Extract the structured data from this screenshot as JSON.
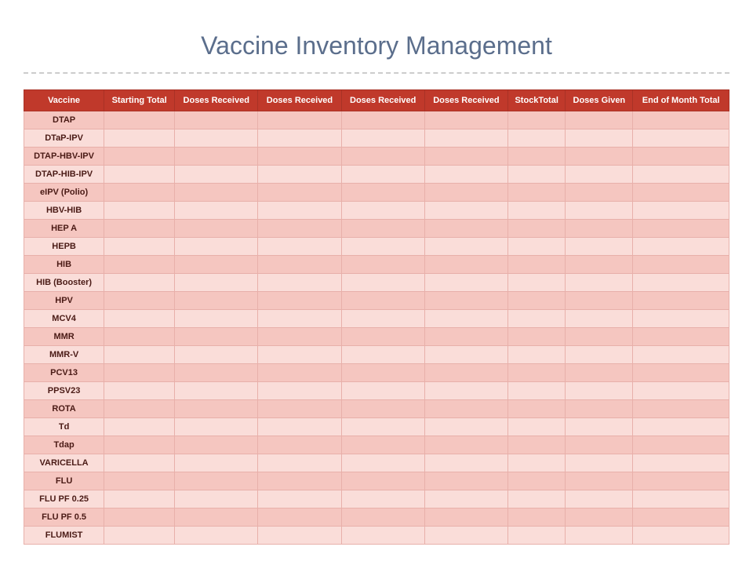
{
  "page": {
    "title": "Vaccine Inventory Management"
  },
  "table": {
    "headers": [
      "Vaccine",
      "Starting Total",
      "Doses Received",
      "Doses Received",
      "Doses Received",
      "Doses Received",
      "StockTotal",
      "Doses Given",
      "End of Month Total"
    ],
    "rows": [
      [
        "DTAP",
        "",
        "",
        "",
        "",
        "",
        "",
        "",
        ""
      ],
      [
        "DTaP-IPV",
        "",
        "",
        "",
        "",
        "",
        "",
        "",
        ""
      ],
      [
        "DTAP-HBV-IPV",
        "",
        "",
        "",
        "",
        "",
        "",
        "",
        ""
      ],
      [
        "DTAP-HIB-IPV",
        "",
        "",
        "",
        "",
        "",
        "",
        "",
        ""
      ],
      [
        "eIPV (Polio)",
        "",
        "",
        "",
        "",
        "",
        "",
        "",
        ""
      ],
      [
        "HBV-HIB",
        "",
        "",
        "",
        "",
        "",
        "",
        "",
        ""
      ],
      [
        "HEP A",
        "",
        "",
        "",
        "",
        "",
        "",
        "",
        ""
      ],
      [
        "HEPB",
        "",
        "",
        "",
        "",
        "",
        "",
        "",
        ""
      ],
      [
        "HIB",
        "",
        "",
        "",
        "",
        "",
        "",
        "",
        ""
      ],
      [
        "HIB (Booster)",
        "",
        "",
        "",
        "",
        "",
        "",
        "",
        ""
      ],
      [
        "HPV",
        "",
        "",
        "",
        "",
        "",
        "",
        "",
        ""
      ],
      [
        "MCV4",
        "",
        "",
        "",
        "",
        "",
        "",
        "",
        ""
      ],
      [
        "MMR",
        "",
        "",
        "",
        "",
        "",
        "",
        "",
        ""
      ],
      [
        "MMR-V",
        "",
        "",
        "",
        "",
        "",
        "",
        "",
        ""
      ],
      [
        "PCV13",
        "",
        "",
        "",
        "",
        "",
        "",
        "",
        ""
      ],
      [
        "PPSV23",
        "",
        "",
        "",
        "",
        "",
        "",
        "",
        ""
      ],
      [
        "ROTA",
        "",
        "",
        "",
        "",
        "",
        "",
        "",
        ""
      ],
      [
        "Td",
        "",
        "",
        "",
        "",
        "",
        "",
        "",
        ""
      ],
      [
        "Tdap",
        "",
        "",
        "",
        "",
        "",
        "",
        "",
        ""
      ],
      [
        "VARICELLA",
        "",
        "",
        "",
        "",
        "",
        "",
        "",
        ""
      ],
      [
        "FLU",
        "",
        "",
        "",
        "",
        "",
        "",
        "",
        ""
      ],
      [
        "FLU PF 0.25",
        "",
        "",
        "",
        "",
        "",
        "",
        "",
        ""
      ],
      [
        "FLU PF 0.5",
        "",
        "",
        "",
        "",
        "",
        "",
        "",
        ""
      ],
      [
        "FLUMIST",
        "",
        "",
        "",
        "",
        "",
        "",
        "",
        ""
      ]
    ]
  }
}
